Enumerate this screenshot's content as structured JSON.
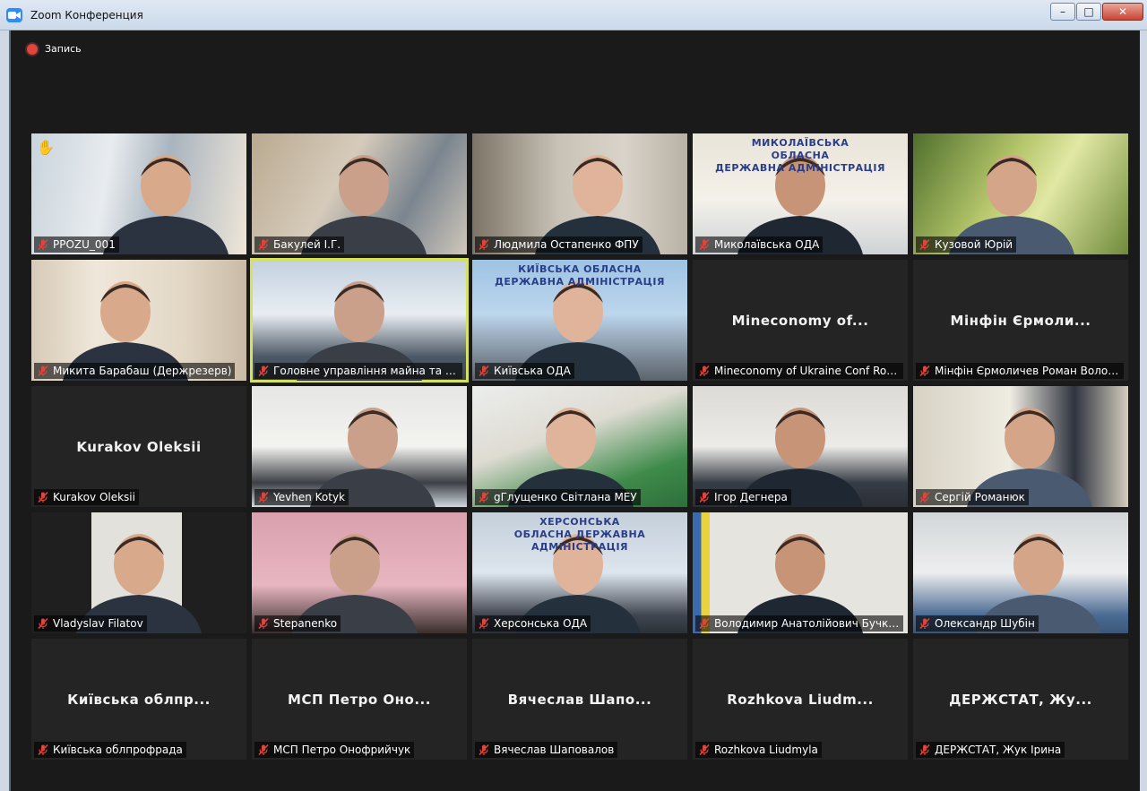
{
  "window": {
    "title": "Zoom Конференция",
    "controls": {
      "minimize": "–",
      "maximize": "□",
      "close": "✕"
    }
  },
  "recording": {
    "label": "Запись"
  },
  "icons": {
    "mute": "muted-mic-icon",
    "record": "record-dot-icon",
    "hand": "raised-hand-icon"
  },
  "colors": {
    "active_speaker": "#d6e35a",
    "record": "#e0443a",
    "mute": "#e0443a"
  },
  "participants": [
    {
      "label": "PPOZU_001",
      "video": true,
      "hand": true
    },
    {
      "label": "Бакулей І.Г.",
      "video": true
    },
    {
      "label": "Людмила Остапенко ФПУ",
      "video": true
    },
    {
      "label": "Миколаївська ОДА",
      "video": true,
      "sign": [
        "МИКОЛАЇВСЬКА",
        "ОБЛАСНА",
        "ДЕРЖАВНА АДМІНІСТРАЦІЯ"
      ]
    },
    {
      "label": "Кузовой Юрій",
      "video": true
    },
    {
      "label": "Микита Барабаш (Держрезерв)",
      "video": true
    },
    {
      "label": "Головне управління майна та ресурсного забезпечення",
      "video": true,
      "active": true
    },
    {
      "label": "Київська ОДА",
      "video": true,
      "sign": [
        "КИЇВСЬКА ОБЛАСНА",
        "ДЕРЖАВНА АДМІНІСТРАЦІЯ"
      ]
    },
    {
      "label": "Mineconomy of Ukraine Conf Room",
      "video": false,
      "display": "Mineconomy  of..."
    },
    {
      "label": "Мінфін Єрмоличев Роман Володимирович",
      "video": false,
      "display": "Мінфін Єрмоли..."
    },
    {
      "label": "Kurakov Oleksii",
      "video": false,
      "display": "Kurakov Oleksii"
    },
    {
      "label": "Yevhen Kotyk",
      "video": true
    },
    {
      "label": "gГлущенко Світлана МЕУ",
      "video": true
    },
    {
      "label": "Ігор Дегнера",
      "video": true
    },
    {
      "label": "Сергій Романюк",
      "video": true
    },
    {
      "label": "Vladyslav  Filatov",
      "video": true
    },
    {
      "label": "Stepanenko",
      "video": true
    },
    {
      "label": "Херсонська ОДА",
      "video": true,
      "sign": [
        "ХЕРСОНСЬКА",
        "ОБЛАСНА ДЕРЖАВНА",
        "АДМІНІСТРАЦІЯ"
      ]
    },
    {
      "label": "Володимир Анатолійович Бучко (Держгеокадастр)",
      "video": true
    },
    {
      "label": "Олександр Шубін",
      "video": true
    },
    {
      "label": "Київська облпрофрада",
      "video": false,
      "display": "Київська  облпр..."
    },
    {
      "label": "МСП Петро Онофрийчук",
      "video": false,
      "display": "МСП  Петро  Оно..."
    },
    {
      "label": "Вячеслав Шаповалов",
      "video": false,
      "display": "Вячеслав  Шапо..."
    },
    {
      "label": "Rozhkova Liudmyla",
      "video": false,
      "display": "Rozhkova  Liudm..."
    },
    {
      "label": "ДЕРЖСТАТ, Жук Ірина",
      "video": false,
      "display": "ДЕРЖСТАТ,  Жу..."
    }
  ]
}
